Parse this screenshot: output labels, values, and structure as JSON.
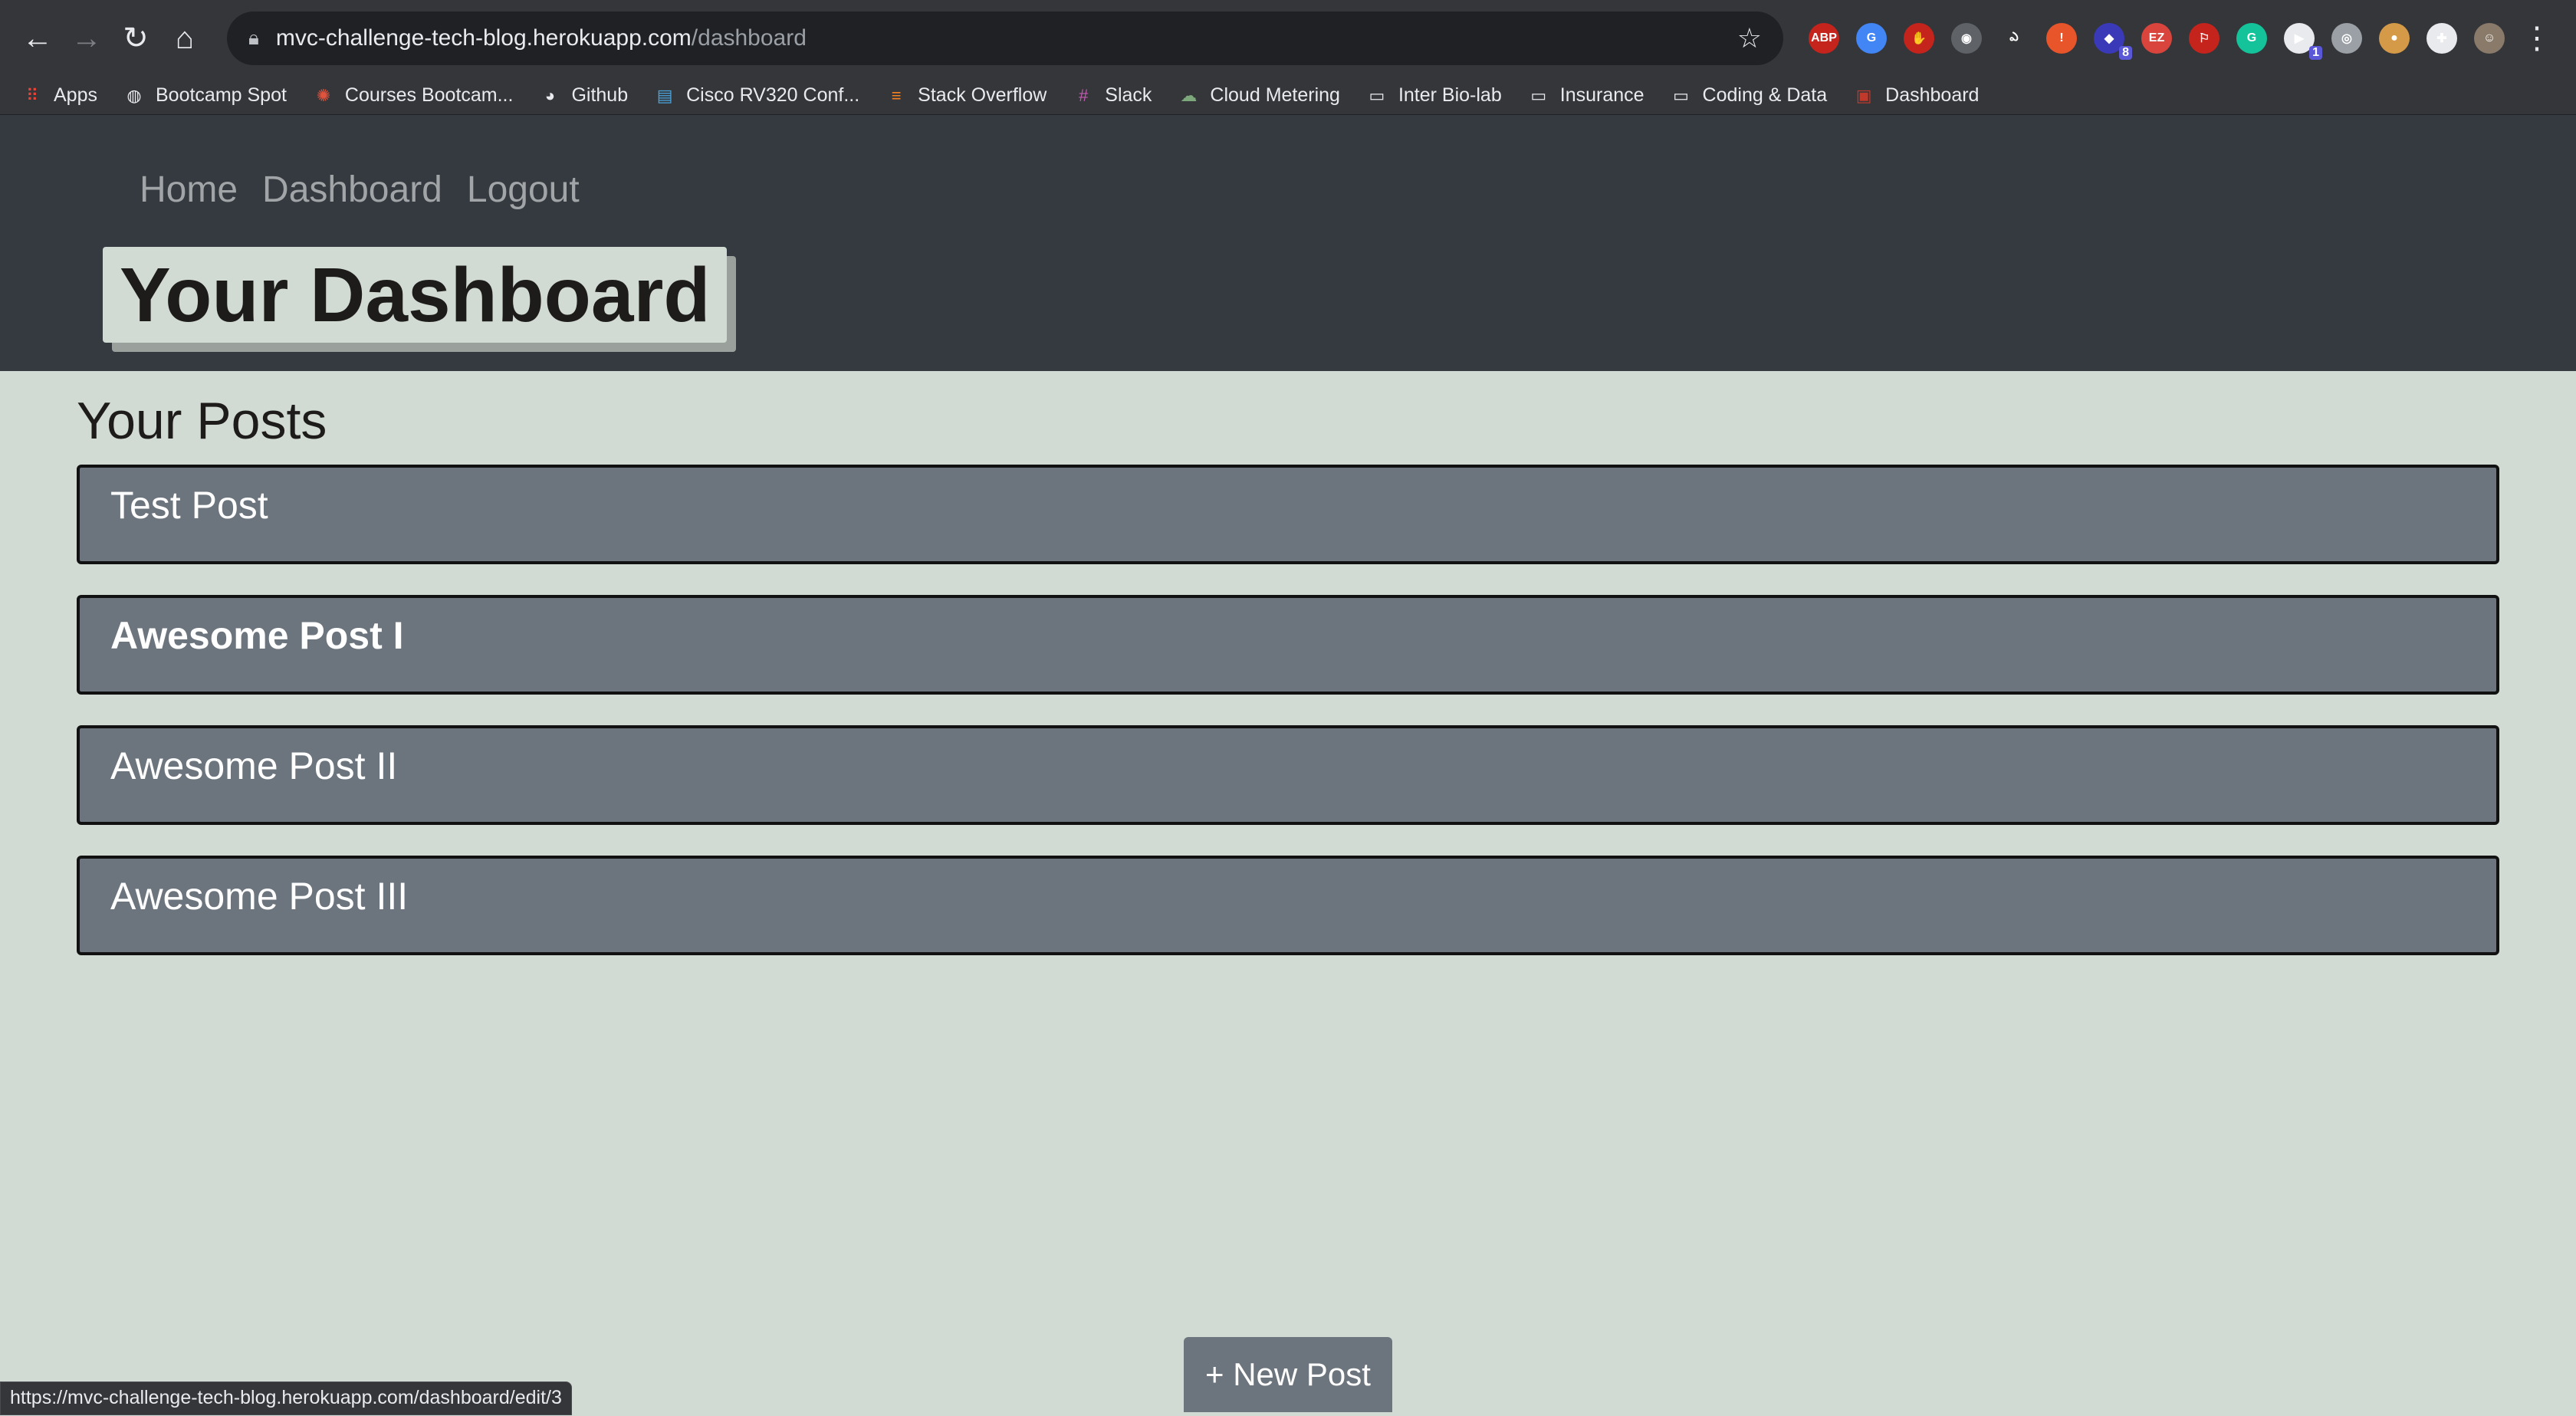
{
  "browser": {
    "url_host": "mvc-challenge-tech-blog.herokuapp.com",
    "url_path": "/dashboard",
    "status_url": "https://mvc-challenge-tech-blog.herokuapp.com/dashboard/edit/3",
    "extensions": [
      {
        "name": "adblock-plus-icon",
        "label": "ABP",
        "color": "#c5241c"
      },
      {
        "name": "google-translate-icon",
        "label": "G",
        "color": "#4285f4"
      },
      {
        "name": "ublock-icon",
        "label": "✋",
        "color": "#c5241c"
      },
      {
        "name": "circle-ext-icon",
        "label": "◉",
        "color": "#5f6368"
      },
      {
        "name": "hook-ext-icon",
        "label": "ఎ",
        "color": "#35363a"
      },
      {
        "name": "alert-ext-icon",
        "label": "!",
        "color": "#e8552b"
      },
      {
        "name": "stack-ext-icon",
        "label": "◆",
        "color": "#3a3ab8",
        "badge": "8"
      },
      {
        "name": "ez-ext-icon",
        "label": "EZ",
        "color": "#d9453c"
      },
      {
        "name": "pdf-icon",
        "label": "⚐",
        "color": "#c5241c"
      },
      {
        "name": "grammarly-icon",
        "label": "G",
        "color": "#15c39a"
      },
      {
        "name": "cast-ext-icon",
        "label": "▶",
        "color": "#e8eaed",
        "badge": "1"
      },
      {
        "name": "camera-ext-icon",
        "label": "◎",
        "color": "#9aa0a6"
      },
      {
        "name": "cookie-icon",
        "label": "●",
        "color": "#d49a47"
      },
      {
        "name": "puzzle-icon",
        "label": "✚",
        "color": "#e8eaed"
      },
      {
        "name": "profile-avatar-icon",
        "label": "☺",
        "color": "#8a7a6a"
      }
    ],
    "bookmarks": [
      {
        "name": "bookmark-apps",
        "icon": "apps-grid-icon",
        "glyph": "⠿",
        "color": "#ea4335",
        "label": "Apps"
      },
      {
        "name": "bookmark-bootcamp-spot",
        "icon": "globe-icon",
        "glyph": "◍",
        "color": "#e8eaed",
        "label": "Bootcamp Spot"
      },
      {
        "name": "bookmark-courses-bootcamp",
        "icon": "courses-icon",
        "glyph": "✺",
        "color": "#e0533d",
        "label": "Courses Bootcam..."
      },
      {
        "name": "bookmark-github",
        "icon": "github-icon",
        "glyph": "◕",
        "color": "#e8eaed",
        "label": "Github"
      },
      {
        "name": "bookmark-cisco",
        "icon": "cisco-icon",
        "glyph": "▤",
        "color": "#49a4dc",
        "label": "Cisco RV320 Conf..."
      },
      {
        "name": "bookmark-stack-overflow",
        "icon": "stack-overflow-icon",
        "glyph": "≡",
        "color": "#f48024",
        "label": "Stack Overflow"
      },
      {
        "name": "bookmark-slack",
        "icon": "slack-icon",
        "glyph": "#",
        "color": "#c25bb3",
        "label": "Slack"
      },
      {
        "name": "bookmark-cloud-metering",
        "icon": "cloud-icon",
        "glyph": "☁",
        "color": "#7ca87c",
        "label": "Cloud Metering"
      },
      {
        "name": "bookmark-inter-bio-lab",
        "icon": "folder-icon",
        "glyph": "▭",
        "color": "#e8eaed",
        "label": "Inter Bio-lab"
      },
      {
        "name": "bookmark-insurance",
        "icon": "folder-icon",
        "glyph": "▭",
        "color": "#e8eaed",
        "label": "Insurance"
      },
      {
        "name": "bookmark-coding-data",
        "icon": "folder-icon",
        "glyph": "▭",
        "color": "#e8eaed",
        "label": "Coding & Data"
      },
      {
        "name": "bookmark-dashboard",
        "icon": "dashboard-icon",
        "glyph": "▣",
        "color": "#c0392b",
        "label": "Dashboard"
      }
    ]
  },
  "nav": {
    "home": "Home",
    "dashboard": "Dashboard",
    "logout": "Logout"
  },
  "page_title": "Your Dashboard",
  "posts_heading": "Your Posts",
  "posts": [
    {
      "title": "Test Post"
    },
    {
      "title": "Awesome Post I"
    },
    {
      "title": "Awesome Post II"
    },
    {
      "title": "Awesome Post III"
    }
  ],
  "new_post_label": "+ New Post"
}
